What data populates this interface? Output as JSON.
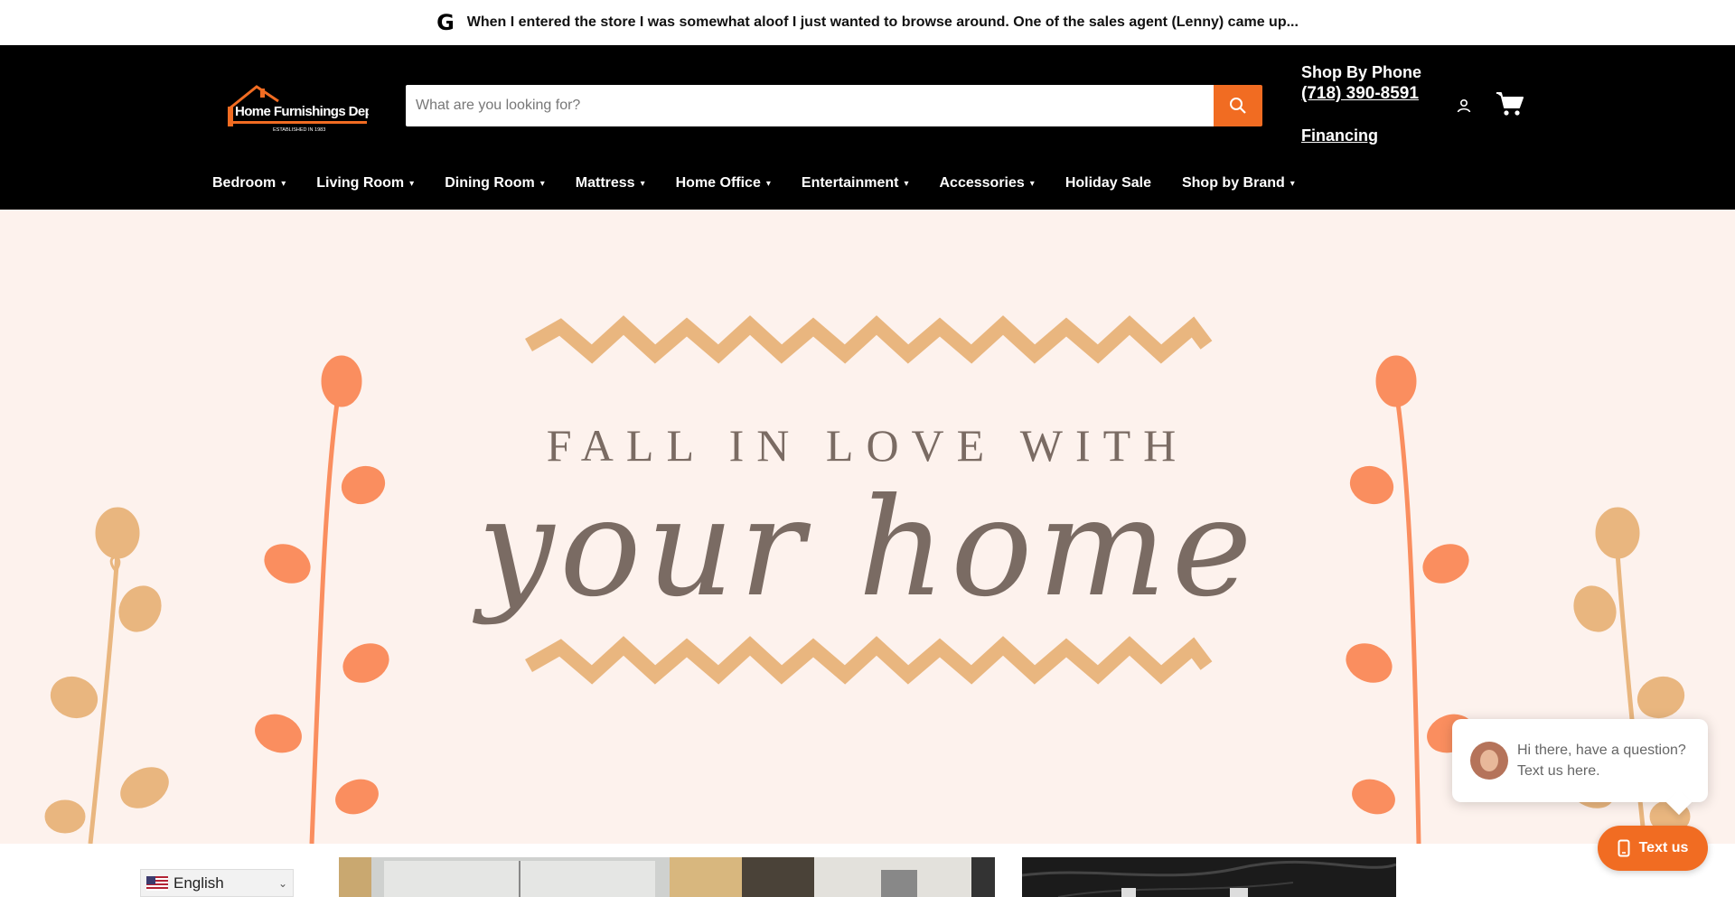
{
  "announcement": {
    "icon": "google-icon",
    "text": "When I entered the store I was somewhat aloof I just wanted to browse around. One of the sales agent (Lenny) came up..."
  },
  "header": {
    "logo_text": "Home Furnishings Depot",
    "logo_tagline": "ESTABLISHED IN 1983",
    "search_placeholder": "What are you looking for?",
    "phone_title": "Shop By Phone",
    "phone_number": "(718) 390-8591",
    "financing_label": "Financing"
  },
  "nav": {
    "items": [
      {
        "label": "Bedroom",
        "dropdown": true
      },
      {
        "label": "Living Room",
        "dropdown": true
      },
      {
        "label": "Dining Room",
        "dropdown": true
      },
      {
        "label": "Mattress",
        "dropdown": true
      },
      {
        "label": "Home Office",
        "dropdown": true
      },
      {
        "label": "Entertainment",
        "dropdown": true
      },
      {
        "label": "Accessories",
        "dropdown": true
      },
      {
        "label": "Holiday Sale",
        "dropdown": false
      },
      {
        "label": "Shop by Brand",
        "dropdown": true
      }
    ]
  },
  "hero": {
    "line1": "FALL IN LOVE WITH",
    "line2": "your home"
  },
  "chat": {
    "bubble_text": "Hi there, have a question? Text us here.",
    "button_label": "Text us"
  },
  "language": {
    "selected": "English"
  },
  "colors": {
    "accent": "#f16c22",
    "header_bg": "#000000",
    "hero_bg": "#fdf2ed",
    "leaf_orange": "#fa8e5f",
    "leaf_tan": "#e9b67f",
    "script_brown": "#7a6b63"
  }
}
